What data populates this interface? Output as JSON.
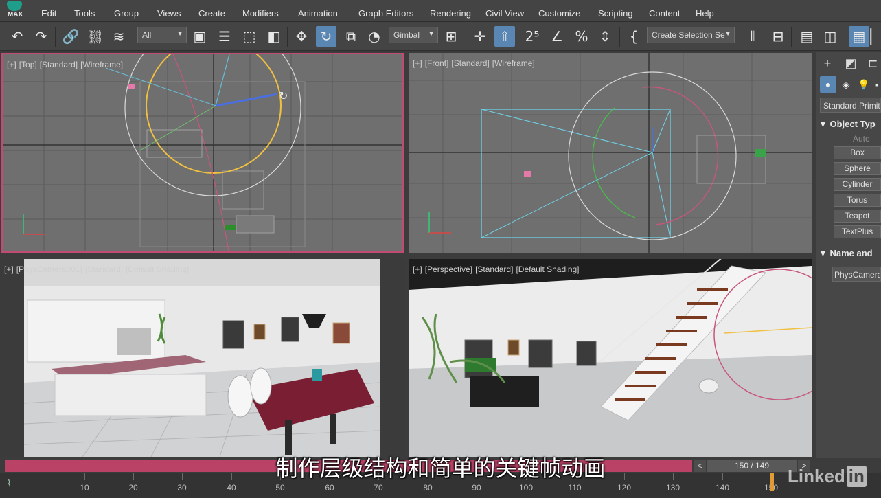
{
  "app": {
    "logo_text": "MAX"
  },
  "menu": [
    "Edit",
    "Tools",
    "Group",
    "Views",
    "Create",
    "Modifiers",
    "Animation",
    "Graph Editors",
    "Rendering",
    "Civil View",
    "Customize",
    "Scripting",
    "Content",
    "Help"
  ],
  "toolbar": {
    "selection_filter": "All",
    "reference_coord": "Gimbal",
    "named_selection": "Create Selection Se"
  },
  "viewports": {
    "top": [
      "[+]",
      "[Top]",
      "[Standard]",
      "[Wireframe]"
    ],
    "front": [
      "[+]",
      "[Front]",
      "[Standard]",
      "[Wireframe]"
    ],
    "camera": [
      "[+]",
      "[PhysCamera001]",
      "[Standard]",
      "[Default Shading]"
    ],
    "perspective": [
      "[+]",
      "[Perspective]",
      "[Standard]",
      "[Default Shading]"
    ]
  },
  "command_panel": {
    "category": "Standard Primiti",
    "object_type_title": "Object Typ",
    "autogrid": "Auto",
    "buttons": [
      "Box",
      "Sphere",
      "Cylinder",
      "Torus",
      "Teapot",
      "TextPlus"
    ],
    "name_color_title": "Name and",
    "object_name": "PhysCamera"
  },
  "timeline": {
    "frame": "150 / 149",
    "prev": "<",
    "next": ">",
    "ticks": [
      "10",
      "20",
      "30",
      "40",
      "50",
      "60",
      "70",
      "80",
      "90",
      "100",
      "110",
      "120",
      "130",
      "140",
      "150"
    ]
  },
  "subtitle": "制作层级结构和简单的关键帧动画",
  "watermark": {
    "text": "Linked",
    "badge": "in"
  },
  "colors": {
    "accent": "#5a86b3",
    "time_slider": "#b94266",
    "active_border": "#c24b74"
  }
}
